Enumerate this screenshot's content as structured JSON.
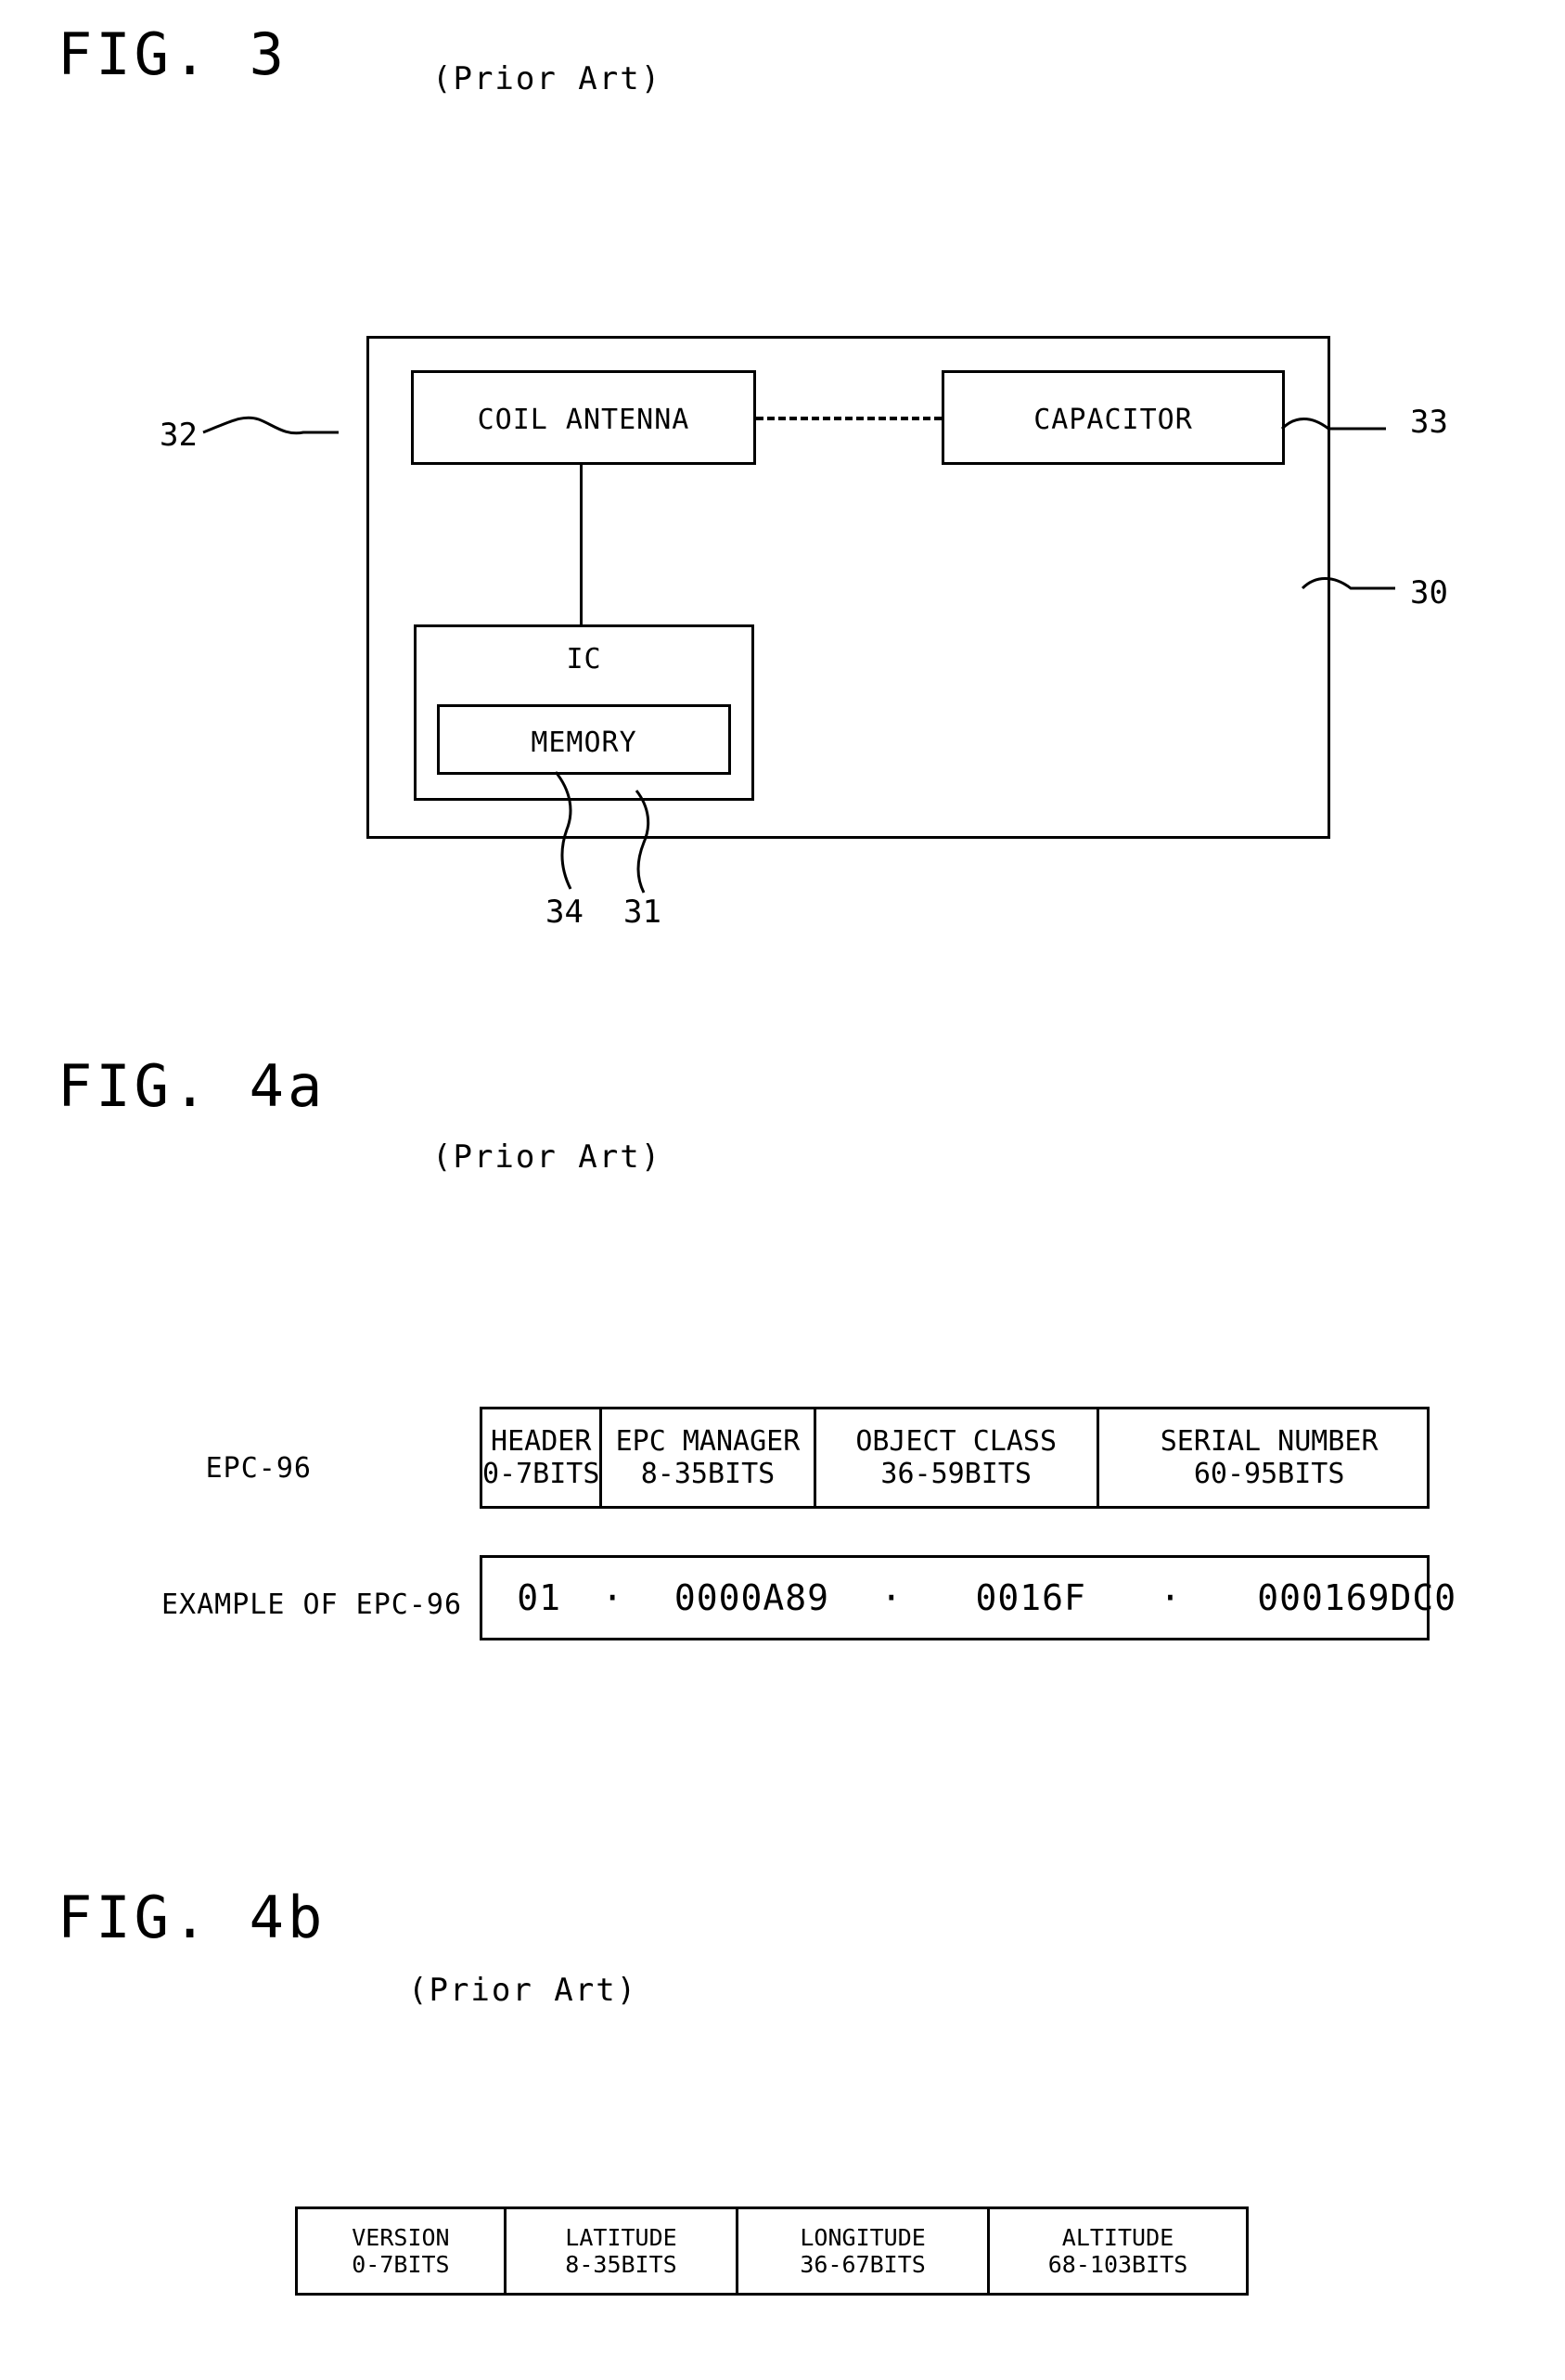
{
  "figures": [
    {
      "id": "fig3",
      "label": "FIG. 3",
      "prior_art": "(Prior Art)"
    },
    {
      "id": "fig4a",
      "label": "FIG. 4a",
      "prior_art": "(Prior Art)"
    },
    {
      "id": "fig4b",
      "label": "FIG. 4b",
      "prior_art": "(Prior Art)"
    }
  ],
  "fig3": {
    "label": "FIG. 3",
    "prior_art": "(Prior Art)",
    "blocks": {
      "coil_antenna": "COIL ANTENNA",
      "capacitor": "CAPACITOR",
      "ic": "IC",
      "memory": "MEMORY"
    },
    "reference_numerals": {
      "coil_antenna": "32",
      "capacitor": "33",
      "tag": "30",
      "memory": "34",
      "ic": "31"
    }
  },
  "fig4a": {
    "label": "FIG. 4a",
    "prior_art": "(Prior Art)",
    "row_labels": {
      "structure": "EPC-96",
      "example": "EXAMPLE OF EPC-96"
    },
    "fields": [
      {
        "name": "HEADER",
        "bits": "0-7BITS"
      },
      {
        "name": "EPC MANAGER",
        "bits": "8-35BITS"
      },
      {
        "name": "OBJECT CLASS",
        "bits": "36-59BITS"
      },
      {
        "name": "SERIAL NUMBER",
        "bits": "60-95BITS"
      }
    ],
    "example_values": [
      "01",
      "0000A89",
      "0016F",
      "000169DC0"
    ],
    "example_separator": "·"
  },
  "fig4b": {
    "label": "FIG. 4b",
    "prior_art": "(Prior Art)",
    "fields": [
      {
        "name": "VERSION",
        "bits": "0-7BITS"
      },
      {
        "name": "LATITUDE",
        "bits": "8-35BITS"
      },
      {
        "name": "LONGITUDE",
        "bits": "36-67BITS"
      },
      {
        "name": "ALTITUDE",
        "bits": "68-103BITS"
      }
    ]
  },
  "colors": {
    "ink": "#000000",
    "paper": "#ffffff"
  }
}
